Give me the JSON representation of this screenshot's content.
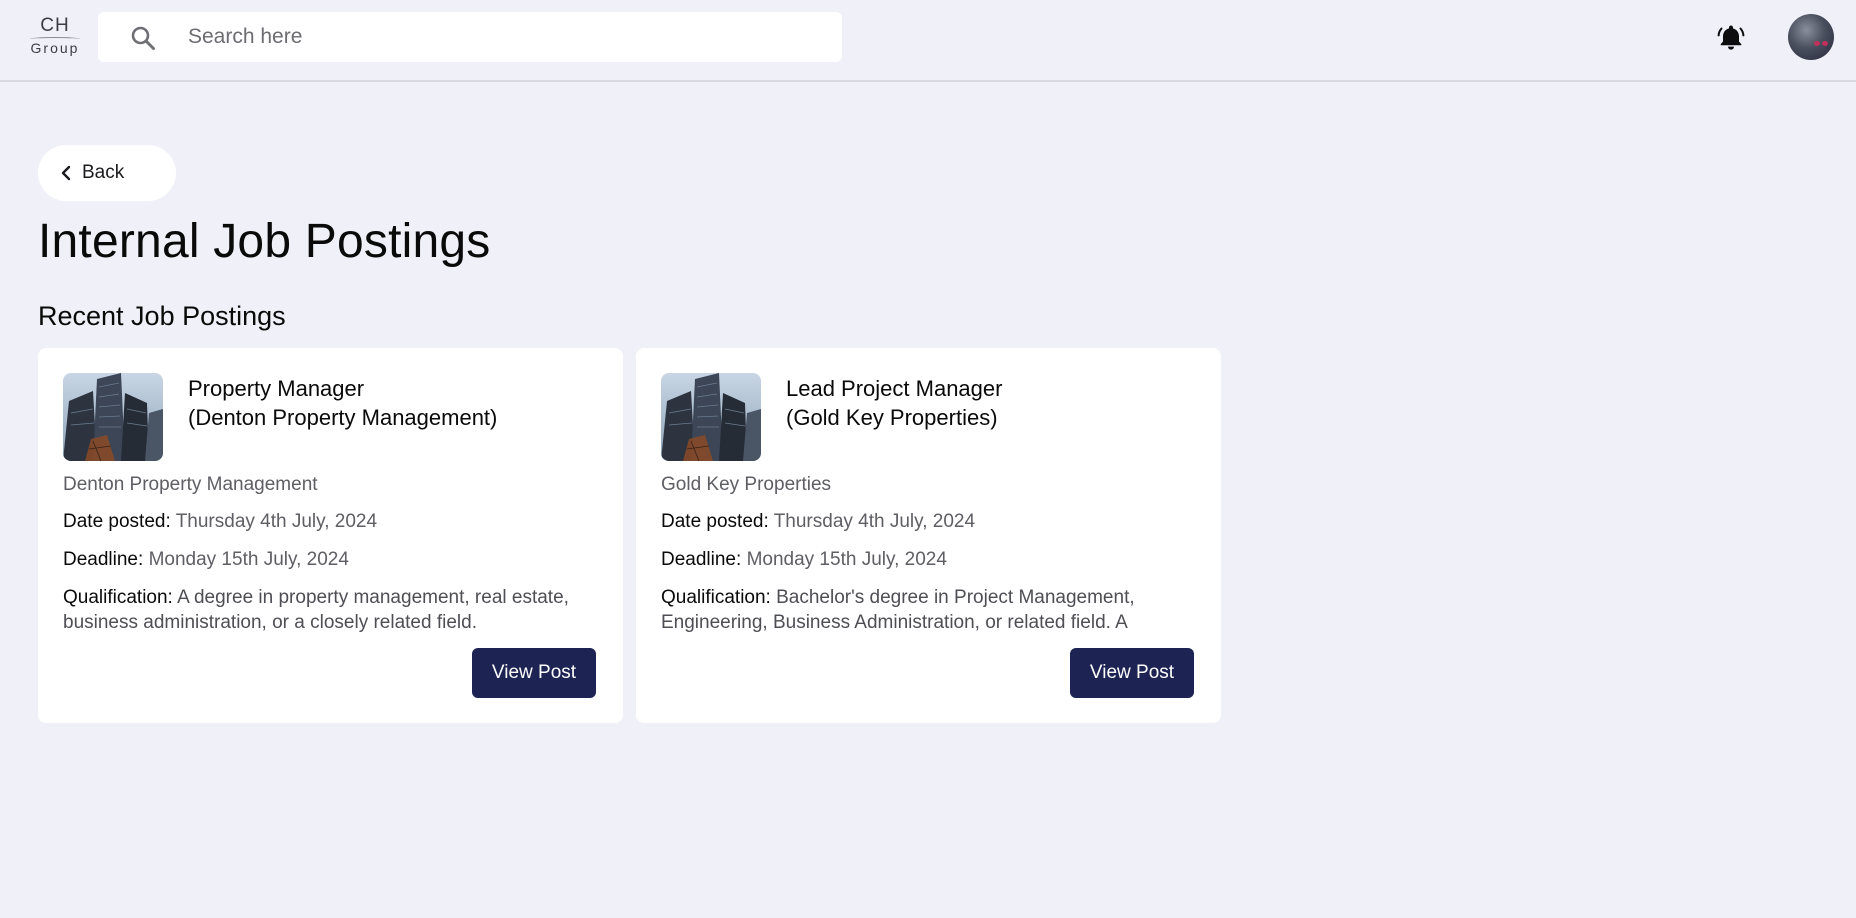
{
  "header": {
    "logo_top": "CH",
    "logo_bottom": "Group",
    "search": {
      "placeholder": "Search here",
      "value": ""
    }
  },
  "page": {
    "back_label": "Back",
    "title": "Internal Job Postings",
    "section_title": "Recent Job Postings"
  },
  "labels": {
    "date_posted": "Date posted:",
    "deadline": "Deadline:",
    "qualification": "Qualification:",
    "view_post": "View Post"
  },
  "postings": [
    {
      "title_line1": "Property Manager",
      "title_line2": "(Denton Property Management)",
      "company": "Denton Property Management",
      "date_posted": "Thursday 4th July, 2024",
      "deadline": "Monday 15th July, 2024",
      "qualification": "A degree in property management, real estate, business administration, or a closely related field."
    },
    {
      "title_line1": "Lead Project Manager",
      "title_line2": "(Gold Key Properties)",
      "company": "Gold Key Properties",
      "date_posted": "Thursday 4th July, 2024",
      "deadline": "Monday 15th July, 2024",
      "qualification": "Bachelor's degree in Project Management, Engineering, Business Administration, or related field. A"
    }
  ],
  "colors": {
    "background": "#f0f0f8",
    "card": "#ffffff",
    "primary_button": "#1d2353"
  },
  "icons": [
    "search-icon",
    "bell-icon",
    "chevron-left-icon"
  ]
}
